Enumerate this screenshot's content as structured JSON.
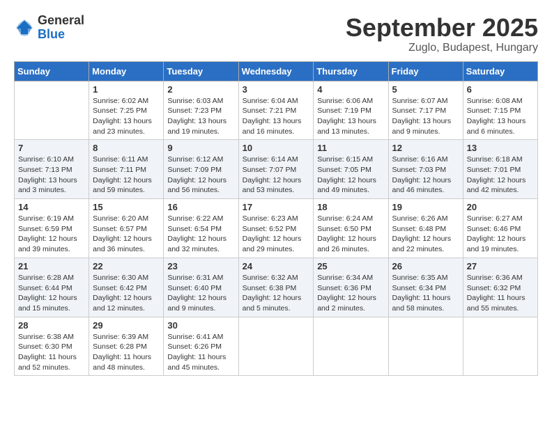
{
  "logo": {
    "general": "General",
    "blue": "Blue"
  },
  "title": "September 2025",
  "location": "Zuglo, Budapest, Hungary",
  "days_of_week": [
    "Sunday",
    "Monday",
    "Tuesday",
    "Wednesday",
    "Thursday",
    "Friday",
    "Saturday"
  ],
  "weeks": [
    [
      {
        "day": "",
        "sunrise": "",
        "sunset": "",
        "daylight": ""
      },
      {
        "day": "1",
        "sunrise": "Sunrise: 6:02 AM",
        "sunset": "Sunset: 7:25 PM",
        "daylight": "Daylight: 13 hours and 23 minutes."
      },
      {
        "day": "2",
        "sunrise": "Sunrise: 6:03 AM",
        "sunset": "Sunset: 7:23 PM",
        "daylight": "Daylight: 13 hours and 19 minutes."
      },
      {
        "day": "3",
        "sunrise": "Sunrise: 6:04 AM",
        "sunset": "Sunset: 7:21 PM",
        "daylight": "Daylight: 13 hours and 16 minutes."
      },
      {
        "day": "4",
        "sunrise": "Sunrise: 6:06 AM",
        "sunset": "Sunset: 7:19 PM",
        "daylight": "Daylight: 13 hours and 13 minutes."
      },
      {
        "day": "5",
        "sunrise": "Sunrise: 6:07 AM",
        "sunset": "Sunset: 7:17 PM",
        "daylight": "Daylight: 13 hours and 9 minutes."
      },
      {
        "day": "6",
        "sunrise": "Sunrise: 6:08 AM",
        "sunset": "Sunset: 7:15 PM",
        "daylight": "Daylight: 13 hours and 6 minutes."
      }
    ],
    [
      {
        "day": "7",
        "sunrise": "Sunrise: 6:10 AM",
        "sunset": "Sunset: 7:13 PM",
        "daylight": "Daylight: 13 hours and 3 minutes."
      },
      {
        "day": "8",
        "sunrise": "Sunrise: 6:11 AM",
        "sunset": "Sunset: 7:11 PM",
        "daylight": "Daylight: 12 hours and 59 minutes."
      },
      {
        "day": "9",
        "sunrise": "Sunrise: 6:12 AM",
        "sunset": "Sunset: 7:09 PM",
        "daylight": "Daylight: 12 hours and 56 minutes."
      },
      {
        "day": "10",
        "sunrise": "Sunrise: 6:14 AM",
        "sunset": "Sunset: 7:07 PM",
        "daylight": "Daylight: 12 hours and 53 minutes."
      },
      {
        "day": "11",
        "sunrise": "Sunrise: 6:15 AM",
        "sunset": "Sunset: 7:05 PM",
        "daylight": "Daylight: 12 hours and 49 minutes."
      },
      {
        "day": "12",
        "sunrise": "Sunrise: 6:16 AM",
        "sunset": "Sunset: 7:03 PM",
        "daylight": "Daylight: 12 hours and 46 minutes."
      },
      {
        "day": "13",
        "sunrise": "Sunrise: 6:18 AM",
        "sunset": "Sunset: 7:01 PM",
        "daylight": "Daylight: 12 hours and 42 minutes."
      }
    ],
    [
      {
        "day": "14",
        "sunrise": "Sunrise: 6:19 AM",
        "sunset": "Sunset: 6:59 PM",
        "daylight": "Daylight: 12 hours and 39 minutes."
      },
      {
        "day": "15",
        "sunrise": "Sunrise: 6:20 AM",
        "sunset": "Sunset: 6:57 PM",
        "daylight": "Daylight: 12 hours and 36 minutes."
      },
      {
        "day": "16",
        "sunrise": "Sunrise: 6:22 AM",
        "sunset": "Sunset: 6:54 PM",
        "daylight": "Daylight: 12 hours and 32 minutes."
      },
      {
        "day": "17",
        "sunrise": "Sunrise: 6:23 AM",
        "sunset": "Sunset: 6:52 PM",
        "daylight": "Daylight: 12 hours and 29 minutes."
      },
      {
        "day": "18",
        "sunrise": "Sunrise: 6:24 AM",
        "sunset": "Sunset: 6:50 PM",
        "daylight": "Daylight: 12 hours and 26 minutes."
      },
      {
        "day": "19",
        "sunrise": "Sunrise: 6:26 AM",
        "sunset": "Sunset: 6:48 PM",
        "daylight": "Daylight: 12 hours and 22 minutes."
      },
      {
        "day": "20",
        "sunrise": "Sunrise: 6:27 AM",
        "sunset": "Sunset: 6:46 PM",
        "daylight": "Daylight: 12 hours and 19 minutes."
      }
    ],
    [
      {
        "day": "21",
        "sunrise": "Sunrise: 6:28 AM",
        "sunset": "Sunset: 6:44 PM",
        "daylight": "Daylight: 12 hours and 15 minutes."
      },
      {
        "day": "22",
        "sunrise": "Sunrise: 6:30 AM",
        "sunset": "Sunset: 6:42 PM",
        "daylight": "Daylight: 12 hours and 12 minutes."
      },
      {
        "day": "23",
        "sunrise": "Sunrise: 6:31 AM",
        "sunset": "Sunset: 6:40 PM",
        "daylight": "Daylight: 12 hours and 9 minutes."
      },
      {
        "day": "24",
        "sunrise": "Sunrise: 6:32 AM",
        "sunset": "Sunset: 6:38 PM",
        "daylight": "Daylight: 12 hours and 5 minutes."
      },
      {
        "day": "25",
        "sunrise": "Sunrise: 6:34 AM",
        "sunset": "Sunset: 6:36 PM",
        "daylight": "Daylight: 12 hours and 2 minutes."
      },
      {
        "day": "26",
        "sunrise": "Sunrise: 6:35 AM",
        "sunset": "Sunset: 6:34 PM",
        "daylight": "Daylight: 11 hours and 58 minutes."
      },
      {
        "day": "27",
        "sunrise": "Sunrise: 6:36 AM",
        "sunset": "Sunset: 6:32 PM",
        "daylight": "Daylight: 11 hours and 55 minutes."
      }
    ],
    [
      {
        "day": "28",
        "sunrise": "Sunrise: 6:38 AM",
        "sunset": "Sunset: 6:30 PM",
        "daylight": "Daylight: 11 hours and 52 minutes."
      },
      {
        "day": "29",
        "sunrise": "Sunrise: 6:39 AM",
        "sunset": "Sunset: 6:28 PM",
        "daylight": "Daylight: 11 hours and 48 minutes."
      },
      {
        "day": "30",
        "sunrise": "Sunrise: 6:41 AM",
        "sunset": "Sunset: 6:26 PM",
        "daylight": "Daylight: 11 hours and 45 minutes."
      },
      {
        "day": "",
        "sunrise": "",
        "sunset": "",
        "daylight": ""
      },
      {
        "day": "",
        "sunrise": "",
        "sunset": "",
        "daylight": ""
      },
      {
        "day": "",
        "sunrise": "",
        "sunset": "",
        "daylight": ""
      },
      {
        "day": "",
        "sunrise": "",
        "sunset": "",
        "daylight": ""
      }
    ]
  ]
}
